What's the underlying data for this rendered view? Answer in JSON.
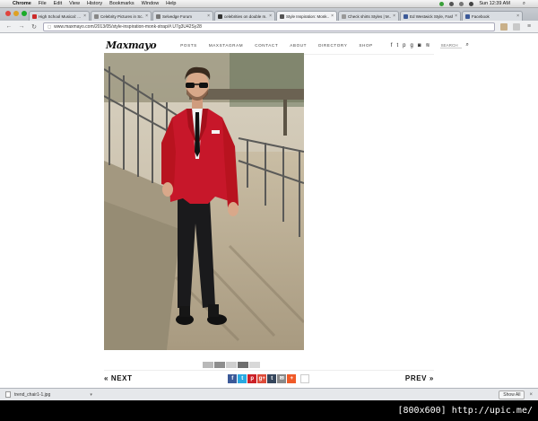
{
  "menubar": {
    "items": [
      "Chrome",
      "File",
      "Edit",
      "View",
      "History",
      "Bookmarks",
      "Window",
      "Help"
    ],
    "clock": "Sun 12:39 AM"
  },
  "tabs": [
    {
      "title": "High School Musical: ...",
      "color": "#cc2a2a",
      "active": false
    },
    {
      "title": "Celebrity Pictures in Sc...",
      "color": "#888888",
      "active": false
    },
    {
      "title": "Selvedge Forum",
      "color": "#777777",
      "active": false
    },
    {
      "title": "celebrities on double m...",
      "color": "#333333",
      "active": false
    },
    {
      "title": "Style Inspiration: Monk...",
      "color": "#555555",
      "active": true
    },
    {
      "title": "Check shirts Styles | M...",
      "color": "#999999",
      "active": false
    },
    {
      "title": "Ed Westwick Style, Fash...",
      "color": "#3b5998",
      "active": false
    },
    {
      "title": "Facebook",
      "color": "#3b5998",
      "active": false
    }
  ],
  "address": {
    "url": "www.maxmayo.com/2013/05/style-inspiration-monk-strap/#.U7g3U42Sy28"
  },
  "site": {
    "logo": "Maxmayo",
    "nav": [
      "POSTS",
      "MAXSTAGRAM",
      "CONTACT",
      "ABOUT",
      "DIRECTORY",
      "SHOP"
    ],
    "socials": [
      {
        "icon": "facebook-icon",
        "glyph": "f"
      },
      {
        "icon": "twitter-icon",
        "glyph": "t"
      },
      {
        "icon": "pinterest-icon",
        "glyph": "p"
      },
      {
        "icon": "google-plus-icon",
        "glyph": "g"
      },
      {
        "icon": "instagram-icon",
        "glyph": "◙"
      },
      {
        "icon": "rss-icon",
        "glyph": "≋"
      }
    ],
    "search_placeholder": "SEARCH"
  },
  "pager": {
    "prev_next_left": "« NEXT",
    "prev_next_right": "PREV »",
    "share_count": "1",
    "share_buttons": [
      {
        "icon": "facebook-share-icon",
        "glyph": "f",
        "color": "#3b5998"
      },
      {
        "icon": "twitter-share-icon",
        "glyph": "t",
        "color": "#29a9e1"
      },
      {
        "icon": "pinterest-share-icon",
        "glyph": "p",
        "color": "#cb2027"
      },
      {
        "icon": "google-plus-share-icon",
        "glyph": "g+",
        "color": "#dd4b39"
      },
      {
        "icon": "tumblr-share-icon",
        "glyph": "t",
        "color": "#35465c"
      },
      {
        "icon": "email-share-icon",
        "glyph": "✉",
        "color": "#8a8a8a"
      },
      {
        "icon": "more-share-icon",
        "glyph": "+",
        "color": "#f05a28"
      }
    ]
  },
  "downloads": {
    "file": "trend_chair1-1.jpg",
    "show_all": "Show All"
  },
  "watermark": "[800x600] http://upic.me/"
}
